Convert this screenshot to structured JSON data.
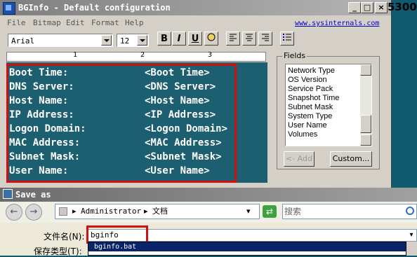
{
  "bginfo": {
    "title": "BGInfo - Default configuration",
    "menu": [
      "File",
      "Bitmap",
      "Edit",
      "Format",
      "Help"
    ],
    "link": "www.sysinternals.com",
    "font_name": "Arial",
    "font_size": "12",
    "format_buttons": [
      "B",
      "I",
      "U"
    ],
    "ruler_numbers": [
      "1",
      "2",
      "3"
    ],
    "rows": [
      {
        "label": "Boot Time:",
        "value": "<Boot Time>"
      },
      {
        "label": "DNS Server:",
        "value": "<DNS Server>"
      },
      {
        "label": "Host Name:",
        "value": "<Host Name>"
      },
      {
        "label": "IP Address:",
        "value": "<IP Address>"
      },
      {
        "label": "Logon Domain:",
        "value": "<Logon Domain>"
      },
      {
        "label": "MAC Address:",
        "value": "<MAC Address>"
      },
      {
        "label": "Subnet Mask:",
        "value": "<Subnet Mask>"
      },
      {
        "label": "User Name:",
        "value": "<User Name>"
      }
    ],
    "fields_label": "Fields",
    "fields": [
      "Network Type",
      "OS Version",
      "Service Pack",
      "Snapshot Time",
      "Subnet Mask",
      "System Type",
      "User Name",
      "Volumes"
    ],
    "add_button": "<- Add",
    "custom_button": "Custom..."
  },
  "corner_text": "5300",
  "save_dialog": {
    "title": "Save as",
    "breadcrumb": [
      "Administrator",
      "文档"
    ],
    "search_placeholder": "搜索",
    "filename_label": "文件名(N):",
    "filename_value": "bginfo",
    "filetype_label": "保存类型(T):",
    "suggestion": "bginfo.bat"
  },
  "colors": {
    "editor_bg": "#1c5f70",
    "highlight": "#d01010",
    "desktop": "#0e5a6f"
  }
}
